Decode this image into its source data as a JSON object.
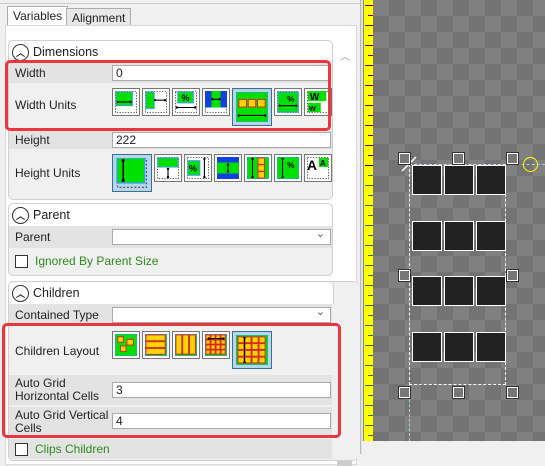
{
  "tabs": [
    {
      "label": "Variables",
      "active": true
    },
    {
      "label": "Alignment",
      "active": false
    }
  ],
  "dimensions": {
    "title": "Dimensions",
    "width_label": "Width",
    "width_value": "0",
    "width_units_label": "Width Units",
    "height_label": "Height",
    "height_value": "222",
    "height_units_label": "Height Units",
    "width_units_selected_index": 4,
    "height_units_selected_index": 0
  },
  "parent": {
    "title": "Parent",
    "parent_label": "Parent",
    "parent_value": "",
    "ignored_label": "Ignored By Parent Size",
    "ignored_checked": false
  },
  "children": {
    "title": "Children",
    "contained_type_label": "Contained Type",
    "contained_type_value": "",
    "layout_label": "Children Layout",
    "layout_selected_index": 4,
    "h_cells_label": "Auto Grid Horizontal Cells",
    "h_cells_value": "3",
    "v_cells_label": "Auto Grid Vertical Cells",
    "v_cells_value": "4",
    "clips_label": "Clips Children",
    "clips_checked": false
  },
  "canvas": {
    "grid_columns": 3,
    "grid_rows": 4
  },
  "colors": {
    "highlight": "#e8383d",
    "ruler": "#ffff00",
    "icon_green": "#00e000"
  }
}
